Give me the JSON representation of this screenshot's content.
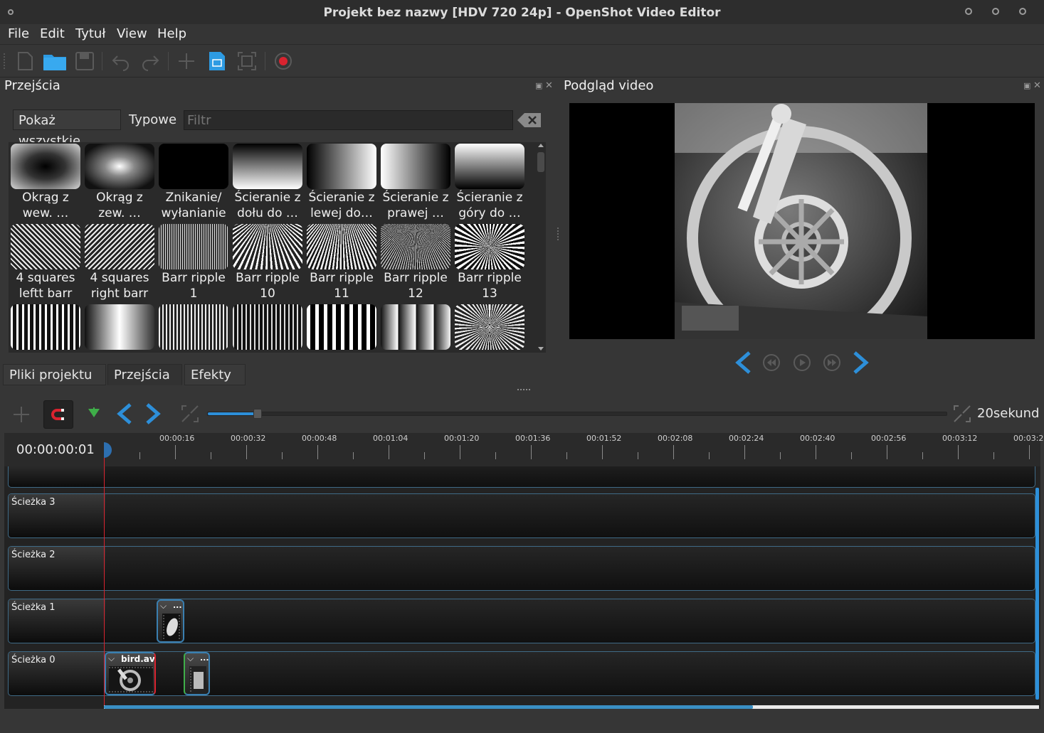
{
  "window": {
    "title": "Projekt bez nazwy [HDV 720 24p] - OpenShot Video Editor"
  },
  "menu": [
    {
      "label": "File"
    },
    {
      "label": "Edit"
    },
    {
      "label": "Tytuł"
    },
    {
      "label": "View"
    },
    {
      "label": "Help"
    }
  ],
  "toolbar": {
    "icons": [
      "new-project-icon",
      "open-project-icon",
      "save-project-icon",
      "undo-icon",
      "redo-icon",
      "import-files-icon",
      "choose-profile-icon",
      "fullscreen-icon",
      "export-video-icon"
    ],
    "accent": "#2d9be3",
    "record": "#d9232f"
  },
  "transitions_panel": {
    "title": "Przejścia",
    "filter_all": "Pokaż wszystkie",
    "filter_common": "Typowe",
    "filter_placeholder": "Filtr",
    "items": [
      {
        "label": "Okrąg z\nwew. …"
      },
      {
        "label": "Okrąg z\nzew. …"
      },
      {
        "label": "Znikanie/\nwyłanianie"
      },
      {
        "label": "Ścieranie z\ndołu do …"
      },
      {
        "label": "Ścieranie z\nlewej do…"
      },
      {
        "label": "Ścieranie z\nprawej …"
      },
      {
        "label": "Ścieranie z\ngóry do …"
      },
      {
        "label": "4 squares\nleftt barr"
      },
      {
        "label": "4 squares\nright barr"
      },
      {
        "label": "Barr ripple\n1"
      },
      {
        "label": "Barr ripple\n10"
      },
      {
        "label": "Barr ripple\n11"
      },
      {
        "label": "Barr ripple\n12"
      },
      {
        "label": "Barr ripple\n13"
      },
      {
        "label": ""
      },
      {
        "label": ""
      },
      {
        "label": ""
      },
      {
        "label": ""
      },
      {
        "label": ""
      },
      {
        "label": ""
      },
      {
        "label": ""
      }
    ]
  },
  "bottom_tabs": [
    {
      "label": "Pliki projektu",
      "active": false
    },
    {
      "label": "Przejścia",
      "active": true
    },
    {
      "label": "Efekty",
      "active": false
    }
  ],
  "preview": {
    "title": "Podgląd video"
  },
  "timeline": {
    "zoom_label": "20sekund",
    "timecode": "00:00:00:01",
    "ruler_labels": [
      "00:00:16",
      "00:00:32",
      "00:00:48",
      "00:01:04",
      "00:01:20",
      "00:01:36",
      "00:01:52",
      "00:02:08",
      "00:02:24",
      "00:02:40",
      "00:02:56",
      "00:03:12",
      "00:03:2"
    ],
    "tracks": [
      {
        "name": "Ścieżka 3"
      },
      {
        "name": "Ścieżka 2"
      },
      {
        "name": "Ścieżka 1"
      },
      {
        "name": "Ścieżka 0"
      }
    ],
    "clips": [
      {
        "track": "Ścieżka 1",
        "title": "..."
      },
      {
        "track": "Ścieżka 0",
        "title": "bird.avi"
      },
      {
        "track": "Ścieżka 0",
        "title": "..."
      }
    ]
  }
}
